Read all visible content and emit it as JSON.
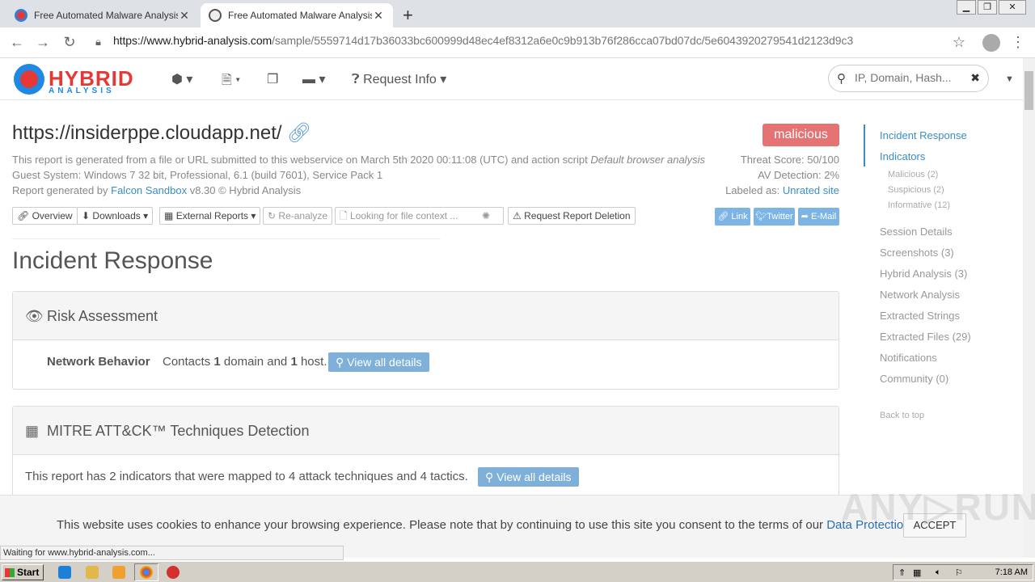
{
  "browser": {
    "tabs": [
      {
        "title": "Free Automated Malware Analysis Se",
        "active": false
      },
      {
        "title": "Free Automated Malware Analysis Se",
        "active": true
      }
    ],
    "url_host": "https://www.hybrid-analysis.com",
    "url_path": "/sample/5559714d17b36033bc600999d48ec4ef8312a6e0c9b913b76f286cca07bd07dc/5e6043920279541d2123d9c3",
    "status_text": "Waiting for www.hybrid-analysis.com..."
  },
  "header": {
    "logo_main": "HYBRID",
    "logo_sub": "ANALYSIS",
    "request_info": "Request Info",
    "search_placeholder": "IP, Domain, Hash..."
  },
  "report": {
    "sample_url": "https://insiderppe.cloudapp.net/",
    "verdict": "malicious",
    "meta_line1_a": "This report is generated from a file or URL submitted to this webservice on March 5th 2020 00:11:08 (UTC) and action script ",
    "meta_line1_b": "Default browser analysis",
    "meta_line2": "Guest System: Windows 7 32 bit, Professional, 6.1 (build 7601), Service Pack 1",
    "meta_line3_a": "Report generated by ",
    "meta_line3_link": "Falcon Sandbox",
    "meta_line3_b": " v8.30 © Hybrid Analysis",
    "threat_score": "Threat Score: 50/100",
    "av_detection": "AV Detection: 2%",
    "labeled_as_label": "Labeled as: ",
    "labeled_as_value": "Unrated site"
  },
  "toolbar": {
    "overview": "Overview",
    "downloads": "Downloads",
    "external_reports": "External Reports",
    "reanalyze": "Re-analyze",
    "file_context": "Looking for file context ...",
    "request_deletion": "Request Report Deletion",
    "share_link": "Link",
    "share_twitter": "Twitter",
    "share_email": "E-Mail"
  },
  "main": {
    "section_title": "Incident Response",
    "risk_title": "Risk Assessment",
    "network_behavior_label": "Network Behavior",
    "network_behavior_text_a": "Contacts ",
    "network_behavior_count1": "1",
    "network_behavior_text_b": " domain and ",
    "network_behavior_count2": "1",
    "network_behavior_text_c": " host.",
    "view_details": "View all details",
    "mitre_title": "MITRE ATT&CK™ Techniques Detection",
    "mitre_text": "This report has 2 indicators that were mapped to 4 attack techniques and 4 tactics."
  },
  "sidebar": {
    "incident_response": "Incident Response",
    "indicators": "Indicators",
    "malicious": "Malicious (2)",
    "suspicious": "Suspicious (2)",
    "informative": "Informative (12)",
    "session_details": "Session Details",
    "screenshots": "Screenshots (3)",
    "hybrid_analysis": "Hybrid Analysis (3)",
    "network_analysis": "Network Analysis",
    "extracted_strings": "Extracted Strings",
    "extracted_files": "Extracted Files (29)",
    "notifications": "Notifications",
    "community": "Community (0)",
    "back_to_top": "Back to top"
  },
  "cookie": {
    "text": "This website uses cookies to enhance your browsing experience. Please note that by continuing to use this site you consent to the terms of our ",
    "link": "Data Protection Policy",
    "end": ".",
    "accept": "ACCEPT"
  },
  "taskbar": {
    "start": "Start",
    "clock": "7:18 AM"
  },
  "colors": {
    "accent": "#3a8dc6",
    "malicious": "#e57373",
    "view_button": "#7fb0d9"
  }
}
